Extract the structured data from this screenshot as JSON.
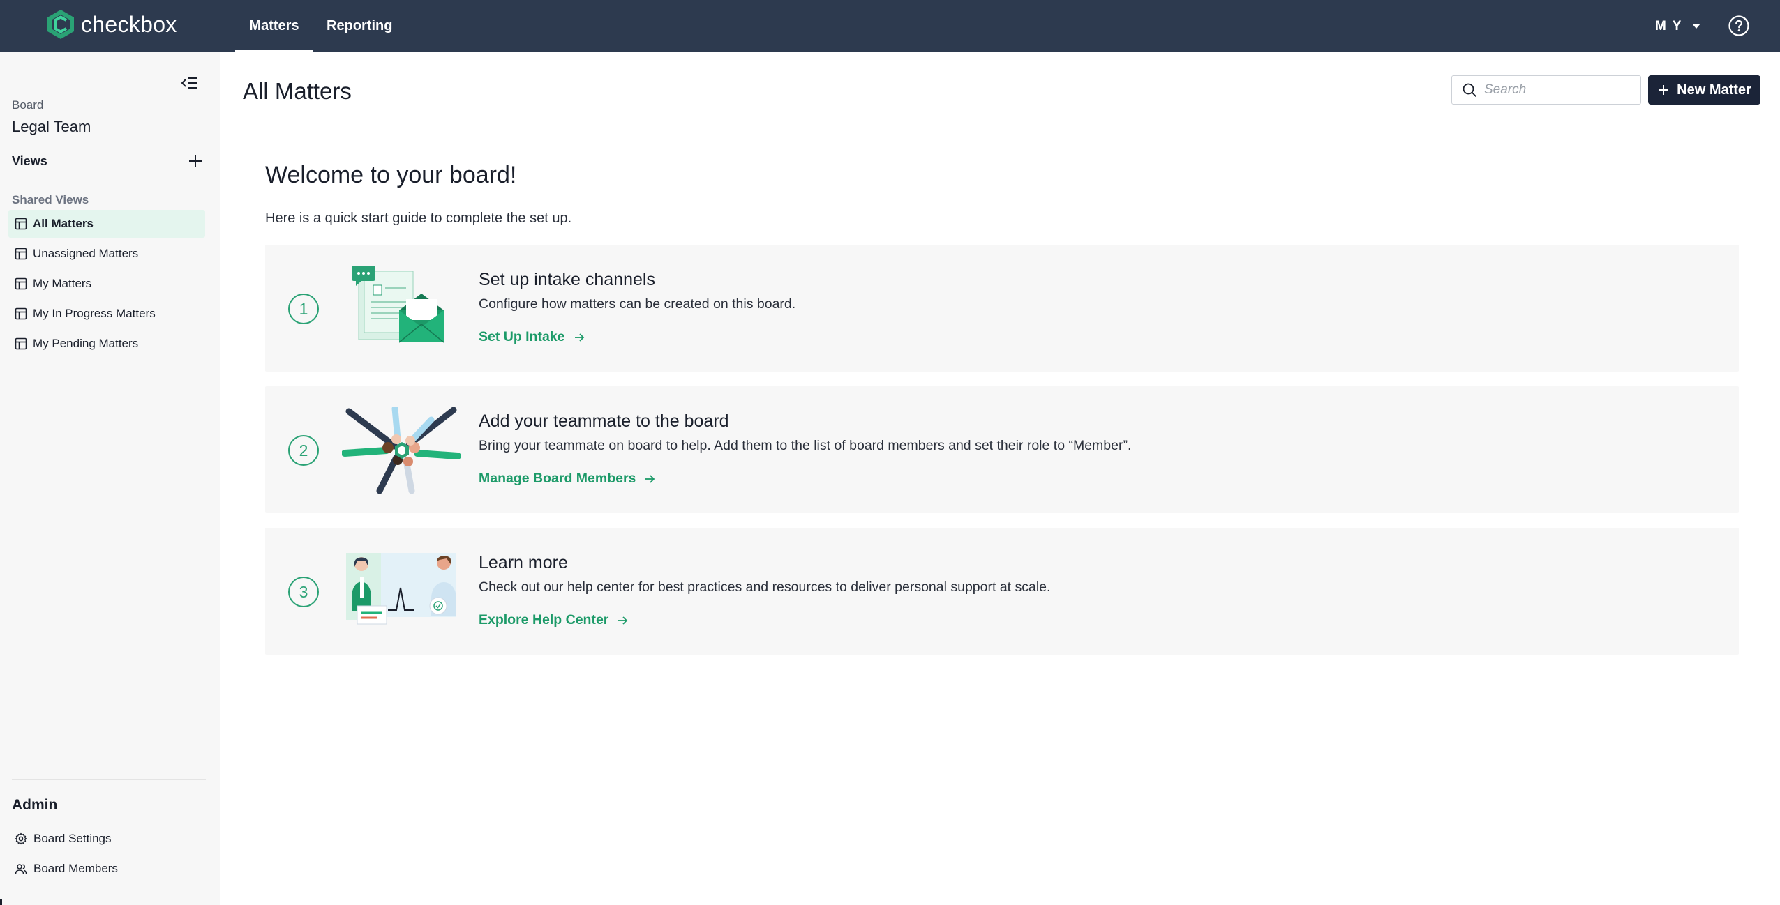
{
  "app": {
    "brand": "checkbox",
    "brand_color": "#2aa275",
    "accent": "#1c9a68",
    "topbar_color": "#2d3a4f"
  },
  "topnav": {
    "tabs": [
      {
        "label": "Matters",
        "active": true
      },
      {
        "label": "Reporting",
        "active": false
      }
    ],
    "user_initials": "M Y",
    "user_menu_icon": "chevron-down-icon",
    "help_icon": "help-circle-icon"
  },
  "sidebar": {
    "board_caption": "Board",
    "board_name": "Legal Team",
    "views_label": "Views",
    "shared_views_label": "Shared Views",
    "items": [
      {
        "label": "All Matters",
        "active": true,
        "icon": "table-icon"
      },
      {
        "label": "Unassigned Matters",
        "active": false,
        "icon": "table-icon"
      },
      {
        "label": "My Matters",
        "active": false,
        "icon": "table-icon"
      },
      {
        "label": "My In Progress Matters",
        "active": false,
        "icon": "table-icon"
      },
      {
        "label": "My Pending Matters",
        "active": false,
        "icon": "table-icon"
      }
    ],
    "admin_label": "Admin",
    "admin_items": [
      {
        "label": "Board Settings",
        "icon": "gear-icon"
      },
      {
        "label": "Board Members",
        "icon": "users-icon"
      }
    ]
  },
  "main": {
    "title": "All Matters",
    "search": {
      "placeholder": "Search",
      "value": ""
    },
    "new_button_label": "New Matter",
    "welcome_title": "Welcome to your board!",
    "welcome_sub": "Here is a quick start guide to complete the set up.",
    "steps": [
      {
        "number": "1",
        "title": "Set up intake channels",
        "description": "Configure how matters can be created on this board.",
        "link": "Set Up Intake"
      },
      {
        "number": "2",
        "title": "Add your teammate to the board",
        "description": "Bring your teammate on board to help. Add them to the list of board members and set their role to “Member”.",
        "link": "Manage Board Members"
      },
      {
        "number": "3",
        "title": "Learn more",
        "description": "Check out our help center for best practices and resources to deliver personal support at scale.",
        "link": "Explore Help Center"
      }
    ]
  }
}
